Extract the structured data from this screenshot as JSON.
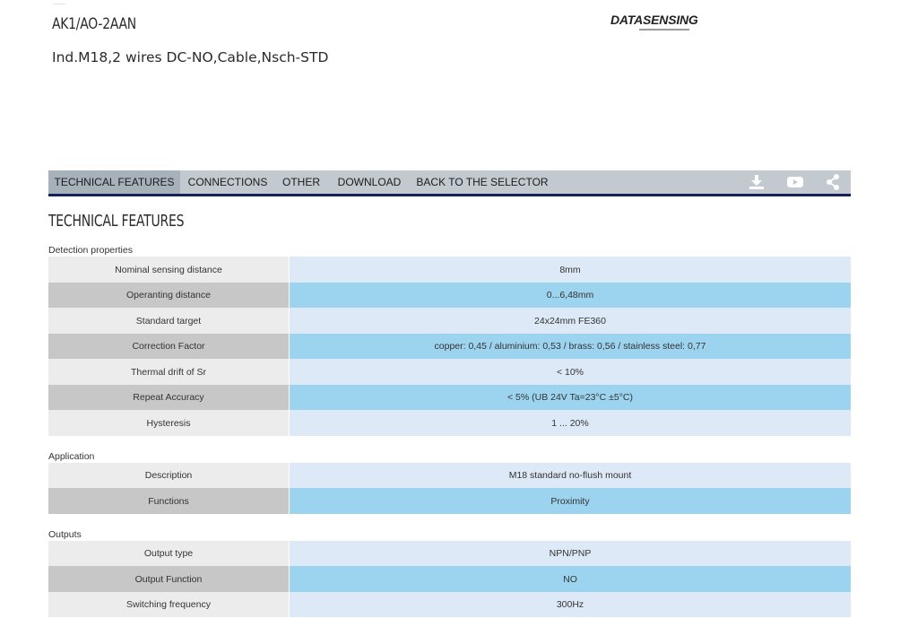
{
  "header": {
    "product_code": "AK1/AO-2AAN",
    "product_description": "Ind.M18,2 wires DC-NO,Cable,Nsch-STD",
    "logo_text": "DATASENSING"
  },
  "nav": {
    "tabs": [
      {
        "label": "TECHNICAL FEATURES",
        "active": true
      },
      {
        "label": "CONNECTIONS",
        "active": false
      },
      {
        "label": "OTHER",
        "active": false
      },
      {
        "label": "DOWNLOAD",
        "active": false
      },
      {
        "label": "BACK TO THE SELECTOR",
        "active": false
      }
    ],
    "icons": [
      "download-icon",
      "youtube-icon",
      "share-icon"
    ],
    "accent_color": "#14205a"
  },
  "section": {
    "title": "TECHNICAL FEATURES"
  },
  "groups": [
    {
      "label": "Detection properties",
      "rows": [
        {
          "label": "Nominal sensing distance",
          "value": "8mm"
        },
        {
          "label": "Operanting distance",
          "value": "0...6,48mm"
        },
        {
          "label": "Standard target",
          "value": "24x24mm FE360"
        },
        {
          "label": "Correction Factor",
          "value": "copper: 0,45 / aluminium: 0,53 / brass: 0,56 / stainless steel: 0,77"
        },
        {
          "label": "Thermal drift of Sr",
          "value": "< 10%"
        },
        {
          "label": "Repeat Accuracy",
          "value": "< 5% (UB 24V Ta=23°C ±5°C)"
        },
        {
          "label": "Hysteresis",
          "value": "1 ... 20%"
        }
      ]
    },
    {
      "label": "Application",
      "rows": [
        {
          "label": "Description",
          "value": "M18 standard no-flush mount"
        },
        {
          "label": "Functions",
          "value": "Proximity"
        }
      ]
    },
    {
      "label": "Outputs",
      "rows": [
        {
          "label": "Output type",
          "value": "NPN/PNP"
        },
        {
          "label": "Output Function",
          "value": "NO"
        },
        {
          "label": "Switching frequency",
          "value": "300Hz"
        }
      ]
    }
  ],
  "colors": {
    "row_label_light": "#ececec",
    "row_label_dark": "#c7c7c7",
    "row_value_light": "#dde9f6",
    "row_value_dark": "#9cd4ef",
    "nav_bg": "#c2c9cf",
    "nav_active_bg": "#a6b1ba"
  }
}
